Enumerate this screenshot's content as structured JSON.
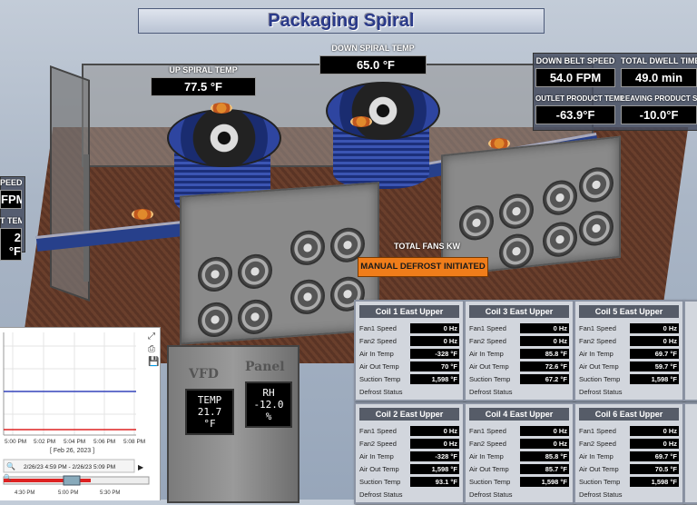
{
  "title": "Packaging Spiral",
  "up_spiral": {
    "label": "UP SPIRAL TEMP",
    "value": "77.5 °F"
  },
  "down_spiral": {
    "label": "DOWN SPIRAL TEMP",
    "value": "65.0 °F"
  },
  "down_belt": {
    "label": "DOWN BELT SPEED",
    "value": "54.0 FPM"
  },
  "dwell": {
    "label": "TOTAL DWELL TIME",
    "value": "49.0 min"
  },
  "outlet": {
    "label": "OUTLET PRODUCT TEMP",
    "value": "-63.9°F"
  },
  "leaving": {
    "label": "LEAVING PRODUCT S",
    "value": "-10.0°F"
  },
  "left_clip": {
    "label1": "PEED",
    "value1": "FPM",
    "label2": "T TEMP",
    "value2": "2 °F"
  },
  "total_fans": "TOTAL FANS KW",
  "defrost_banner": "MANUAL DEFROST INITIATED",
  "cabinet": {
    "vfd": "VFD",
    "panel": "Panel",
    "temp_label": "TEMP",
    "rh_label": "RH",
    "temp_value": "21.7 °F",
    "rh_value": "-12.0 %"
  },
  "row_labels": [
    "Fan1 Speed",
    "Fan2 Speed",
    "Air In Temp",
    "Air Out Temp",
    "Suction Temp",
    "Defrost Status"
  ],
  "coils": [
    {
      "title": "Coil 1 East Upper",
      "values": [
        "0 Hz",
        "0 Hz",
        "-328 °F",
        "70 °F",
        "1,598 °F",
        ""
      ]
    },
    {
      "title": "Coil 3 East Upper",
      "values": [
        "0 Hz",
        "0 Hz",
        "85.8 °F",
        "72.6 °F",
        "67.2 °F",
        ""
      ]
    },
    {
      "title": "Coil 5 East Upper",
      "values": [
        "0 Hz",
        "0 Hz",
        "69.7 °F",
        "59.7 °F",
        "1,598 °F",
        ""
      ]
    },
    {
      "title": "Coil 2 East Upper",
      "values": [
        "0 Hz",
        "0 Hz",
        "-328 °F",
        "1,598 °F",
        "93.1 °F",
        ""
      ]
    },
    {
      "title": "Coil 4 East Upper",
      "values": [
        "0 Hz",
        "0 Hz",
        "85.8 °F",
        "85.7 °F",
        "1,598 °F",
        ""
      ]
    },
    {
      "title": "Coil 6 East Upper",
      "values": [
        "0 Hz",
        "0 Hz",
        "69.7 °F",
        "70.5 °F",
        "1,598 °F",
        ""
      ]
    }
  ],
  "chart": {
    "ticks": [
      "5:00 PM",
      "5:02 PM",
      "5:04 PM",
      "5:06 PM",
      "5:08 PM"
    ],
    "date": "[ Feb 26, 2023 ]",
    "range": "2/26/23 4:59 PM - 2/26/23 5:09 PM",
    "nav_ticks": [
      "4:30 PM",
      "5:00 PM",
      "5:30 PM"
    ],
    "line_colors": [
      "#3344bb",
      "#dd2222"
    ]
  },
  "colors": {
    "banner": "#f07d1a",
    "title_text": "#2a3a8a"
  }
}
